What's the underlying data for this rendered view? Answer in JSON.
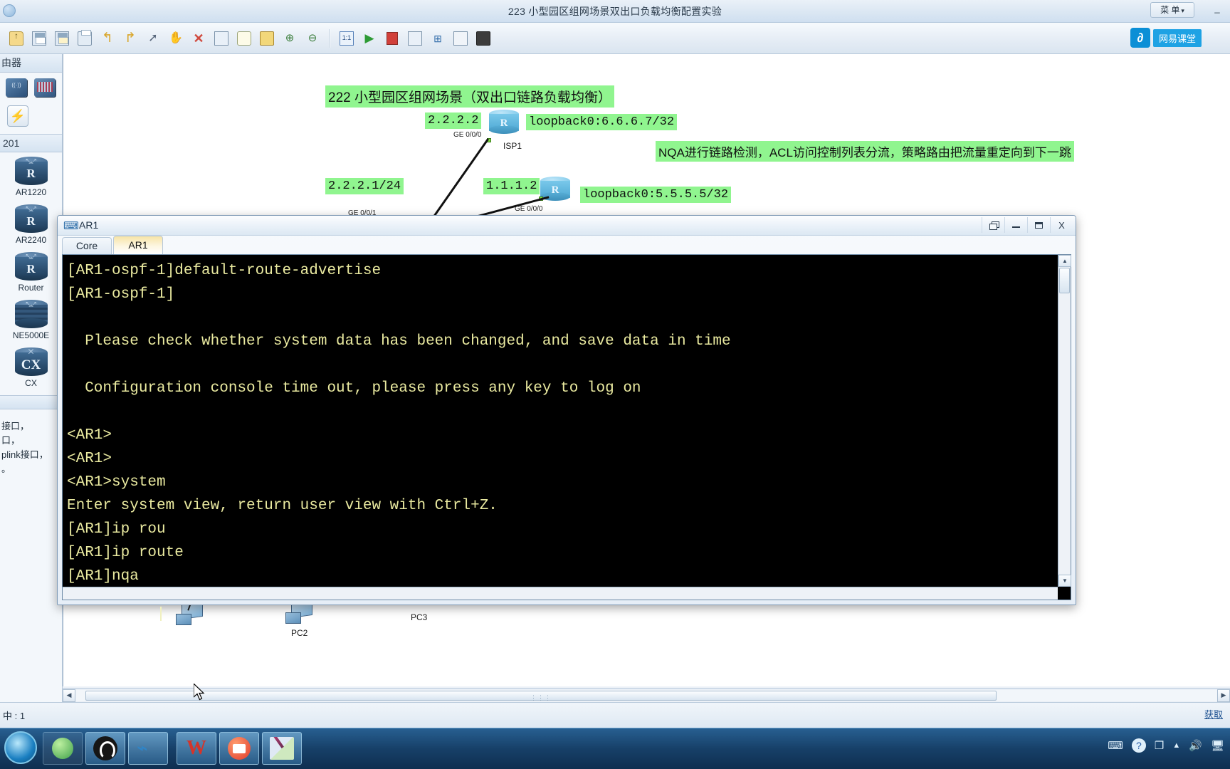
{
  "app": {
    "window_title": "223 小型园区组网场景双出口负载均衡配置实验",
    "menu_button": "菜 单",
    "menu_caret": "▾",
    "top_minimize": "_",
    "watermark": {
      "logo": "∂",
      "text": "网易课堂"
    }
  },
  "toolbar": {
    "buttons": [
      {
        "name": "open-file",
        "label": "Open"
      },
      {
        "name": "save",
        "label": "Save"
      },
      {
        "name": "save-as",
        "label": "Save As"
      },
      {
        "name": "print",
        "label": "Print"
      },
      {
        "name": "undo",
        "label": "Undo",
        "glyph": "↰"
      },
      {
        "name": "redo",
        "label": "Redo",
        "glyph": "↱"
      },
      {
        "name": "select-pointer",
        "label": "Select",
        "glyph": "⌖"
      },
      {
        "name": "pan-hand",
        "label": "Pan",
        "glyph": "✋"
      },
      {
        "name": "delete",
        "label": "Delete",
        "glyph": "✕"
      },
      {
        "name": "delete-link",
        "label": "Delete Link"
      },
      {
        "name": "add-note",
        "label": "Note",
        "glyph": "···"
      },
      {
        "name": "add-text",
        "label": "Text"
      },
      {
        "name": "zoom-in",
        "label": "Zoom In",
        "glyph": "⊕"
      },
      {
        "name": "zoom-out",
        "label": "Zoom Out",
        "glyph": "⊖"
      },
      {
        "name": "zoom-reset",
        "label": "1:1"
      },
      {
        "name": "start-all",
        "label": "Start",
        "glyph": "▶"
      },
      {
        "name": "stop-all",
        "label": "Stop"
      },
      {
        "name": "capture",
        "label": "Capture"
      },
      {
        "name": "topology-tree",
        "label": "Topology",
        "glyph": "⊞"
      },
      {
        "name": "grid",
        "label": "Grid"
      },
      {
        "name": "device-manager",
        "label": "Device"
      }
    ]
  },
  "sidebar": {
    "header": "由器",
    "section_label": "201",
    "top_icons": [
      {
        "name": "wireless-ap-icon",
        "label": "AP"
      },
      {
        "name": "switch-icon",
        "label": "Switch"
      }
    ],
    "bolt_icon": "⚡",
    "devices": [
      {
        "name": "AR1220",
        "glyph": "R"
      },
      {
        "name": "AR2240",
        "glyph": "R"
      },
      {
        "name": "Router",
        "glyph": "R"
      },
      {
        "name": "NE5000E",
        "glyph": ""
      },
      {
        "name": "CX",
        "glyph": "CX"
      }
    ],
    "description_lines": [
      "接口，",
      "口，",
      "plink接口，",
      "。"
    ]
  },
  "canvas": {
    "diagram_title": "222 小型园区组网场景（双出口链路负载均衡）",
    "annotation": "NQA进行链路检测，ACL访问控制列表分流，策略路由把流量重定向到下一跳",
    "labels": [
      {
        "name": "label-isp1-ip",
        "text": "2.2.2.2"
      },
      {
        "name": "label-isp1-loopback",
        "text": "loopback0:6.6.6.7/32"
      },
      {
        "name": "label-ar1-ge001",
        "text": "2.2.2.1/24"
      },
      {
        "name": "label-isp2-ip",
        "text": "1.1.1.2"
      },
      {
        "name": "label-isp2-loopback",
        "text": "loopback0:5.5.5.5/32"
      }
    ],
    "interfaces": [
      {
        "name": "iface-isp1-ge000",
        "text": "GE 0/0/0"
      },
      {
        "name": "iface-ar1-ge001",
        "text": "GE 0/0/1"
      },
      {
        "name": "iface-isp2-ge000",
        "text": "GE 0/0/0"
      }
    ],
    "nodes": [
      {
        "name": "node-isp1",
        "label": "ISP1",
        "glyph": "R"
      },
      {
        "name": "node-isp2",
        "label": "",
        "glyph": "R"
      }
    ],
    "pcs": [
      {
        "name": "pc-unnamed",
        "label": ""
      },
      {
        "name": "pc-pc2",
        "label": "PC2"
      },
      {
        "name": "pc-pc3",
        "label": "PC3"
      }
    ],
    "grip": "⋮⋮⋮"
  },
  "console": {
    "window_title": "AR1",
    "title_icon": "⌨",
    "tabs": [
      {
        "name": "tab-core",
        "label": "Core",
        "active": false
      },
      {
        "name": "tab-ar1",
        "label": "AR1",
        "active": true
      }
    ],
    "window_buttons": [
      {
        "name": "restore-button",
        "label": "restore"
      },
      {
        "name": "minimize-button",
        "label": "minimize"
      },
      {
        "name": "maximize-button",
        "label": "maximize"
      },
      {
        "name": "close-button",
        "label": "X"
      }
    ],
    "terminal_text": "[AR1-ospf-1]default-route-advertise\n[AR1-ospf-1]\n\n  Please check whether system data has been changed, and save data in time\n\n  Configuration console time out, please press any key to log on\n\n<AR1>\n<AR1>\n<AR1>system\nEnter system view, return user view with Ctrl+Z.\n[AR1]ip rou\n[AR1]ip route\n[AR1]nqa",
    "scroll_up": "▲",
    "scroll_down": "▼",
    "scroll_left": "◀",
    "scroll_right": "▶"
  },
  "statusbar": {
    "left_text": "中 : 1",
    "right_text": "获取"
  },
  "taskbar": {
    "items": [
      {
        "name": "taskbar-start",
        "label": "Start"
      },
      {
        "name": "taskbar-browser",
        "label": "Browser"
      },
      {
        "name": "taskbar-obs",
        "label": "OBS"
      },
      {
        "name": "taskbar-ensp",
        "label": "eNSP"
      },
      {
        "name": "taskbar-wps",
        "label": "WPS"
      },
      {
        "name": "taskbar-recorder",
        "label": "Recorder"
      },
      {
        "name": "taskbar-paint",
        "label": "Paint"
      }
    ],
    "tray": [
      {
        "name": "tray-keyboard-icon",
        "glyph": "⌨"
      },
      {
        "name": "tray-help-icon",
        "glyph": "?"
      },
      {
        "name": "tray-windows-icon",
        "glyph": "❐"
      },
      {
        "name": "tray-show-hidden-icon",
        "glyph": "▲"
      },
      {
        "name": "tray-volume-icon",
        "glyph": "🔊"
      },
      {
        "name": "tray-network-icon",
        "glyph": "🖥"
      }
    ]
  },
  "colors": {
    "highlight_green": "#90f58f",
    "terminal_bg": "#000000",
    "terminal_fg": "#eaeaa0",
    "active_tab": "#f7e4a6"
  }
}
